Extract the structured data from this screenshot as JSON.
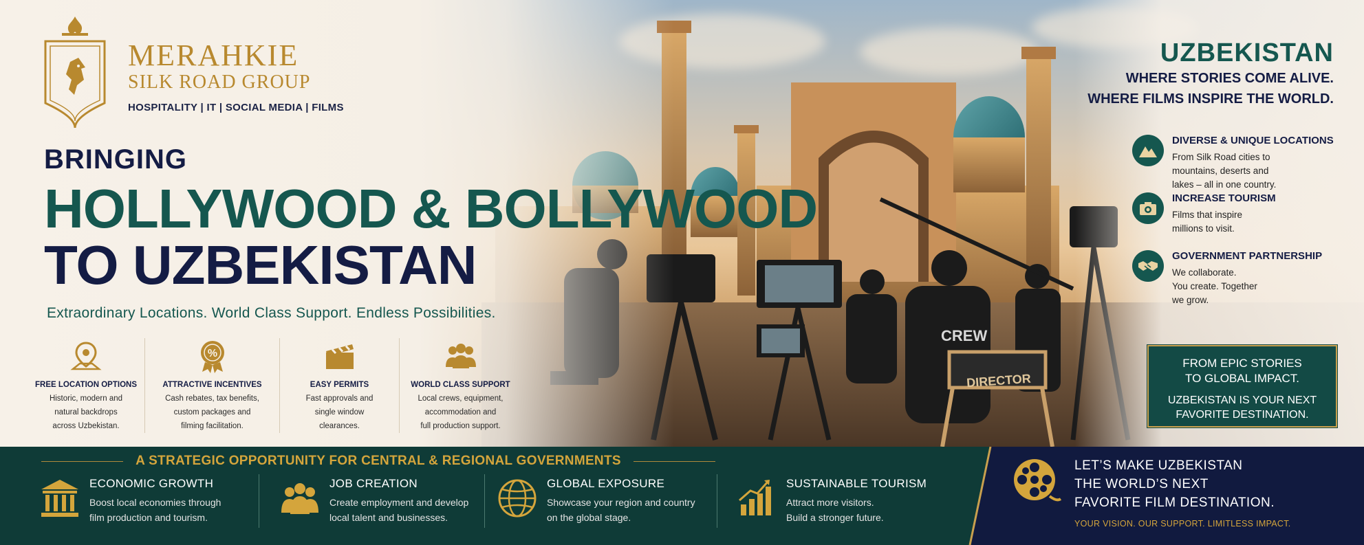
{
  "brand": {
    "name": "MERAHKIE",
    "sub": "SILK ROAD GROUP",
    "tagline": "HOSPITALITY | IT | SOCIAL MEDIA | FILMS"
  },
  "headline": {
    "pre": "BRINGING",
    "main": "HOLLYWOOD & BOLLYWOOD",
    "sub": "TO UZBEKISTAN",
    "tagline": "Extraordinary Locations. World Class Support. Endless Possibilities."
  },
  "features": [
    {
      "icon": "map-pin-icon",
      "title": "FREE LOCATION OPTIONS",
      "desc": [
        "Historic, modern and",
        "natural backdrops",
        "across Uzbekistan."
      ]
    },
    {
      "icon": "percent-badge-icon",
      "title": "ATTRACTIVE INCENTIVES",
      "desc": [
        "Cash rebates, tax benefits,",
        "custom packages and",
        "filming facilitation."
      ]
    },
    {
      "icon": "clapperboard-icon",
      "title": "EASY PERMITS",
      "desc": [
        "Fast approvals and",
        "single window",
        "clearances."
      ]
    },
    {
      "icon": "people-group-icon",
      "title": "WORLD CLASS SUPPORT",
      "desc": [
        "Local crews, equipment,",
        "accommodation and",
        "full production support."
      ]
    }
  ],
  "scene": {
    "crew_shirt": "CREW",
    "director_chair": "DIRECTOR"
  },
  "right": {
    "title": "UZBEKISTAN",
    "line1": "WHERE STORIES COME ALIVE.",
    "line2": "WHERE FILMS INSPIRE THE WORLD.",
    "items": [
      {
        "icon": "mountain-icon",
        "title": "DIVERSE & UNIQUE LOCATIONS",
        "desc": "From Silk Road cities to\nmountains, deserts and\nlakes – all in one country."
      },
      {
        "icon": "camera-icon",
        "title": "INCREASE TOURISM",
        "desc": "Films that inspire\nmillions to visit."
      },
      {
        "icon": "handshake-icon",
        "title": "GOVERNMENT PARTNERSHIP",
        "desc": "We collaborate.\nYou create. Together\nwe grow."
      }
    ],
    "box_line1": "FROM EPIC STORIES\nTO GLOBAL IMPACT.",
    "box_line2": "UZBEKISTAN IS YOUR NEXT\nFAVORITE DESTINATION."
  },
  "opportunity": {
    "title": "A STRATEGIC OPPORTUNITY FOR CENTRAL & REGIONAL GOVERNMENTS",
    "items": [
      {
        "icon": "government-building-icon",
        "title": "ECONOMIC GROWTH",
        "desc": "Boost local economies through\nfilm production and tourism."
      },
      {
        "icon": "people-icon",
        "title": "JOB CREATION",
        "desc": "Create employment and develop\nlocal talent and businesses."
      },
      {
        "icon": "globe-icon",
        "title": "GLOBAL EXPOSURE",
        "desc": "Showcase your region and country\non the global stage."
      },
      {
        "icon": "growth-chart-icon",
        "title": "SUSTAINABLE TOURISM",
        "desc": "Attract more visitors.\nBuild a stronger future."
      }
    ]
  },
  "cta": {
    "icon": "film-reel-icon",
    "title": "LET’S MAKE UZBEKISTAN\nTHE WORLD’S NEXT\nFAVORITE FILM DESTINATION.",
    "sub": "YOUR VISION. OUR SUPPORT. LIMITLESS IMPACT."
  },
  "colors": {
    "gold": "#b8892f",
    "teal": "#15574f",
    "navy": "#141c44",
    "band_green": "#0f3b37",
    "band_navy": "#111a3f"
  }
}
